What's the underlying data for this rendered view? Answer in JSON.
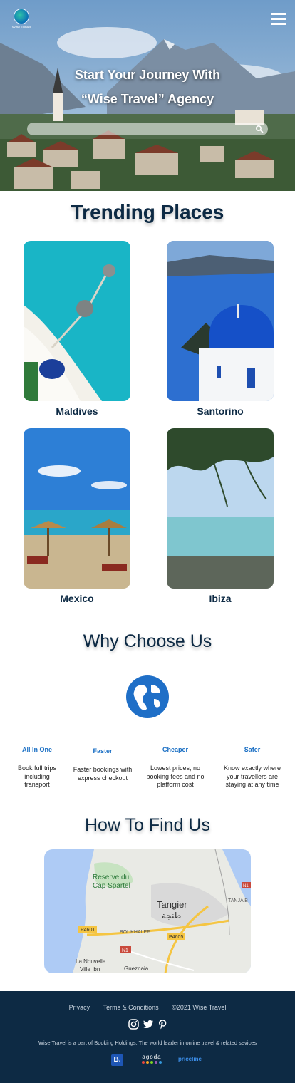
{
  "header": {
    "logo_text": "Wise Travel",
    "hero_title_line1": "Start Your Journey With",
    "hero_title_line2": "“Wise Travel” Agency",
    "search_placeholder": ""
  },
  "trending": {
    "title": "Trending Places",
    "places": [
      {
        "name": "Maldives"
      },
      {
        "name": "Santorino"
      },
      {
        "name": "Mexico"
      },
      {
        "name": "Ibiza"
      }
    ]
  },
  "why": {
    "title": "Why Choose Us",
    "features": [
      {
        "title": "All In One",
        "desc": "Book full trips including transport"
      },
      {
        "title": "Faster",
        "desc": "Faster bookings with express checkout"
      },
      {
        "title": "Cheaper",
        "desc": "Lowest prices, no booking fees and no platform cost"
      },
      {
        "title": "Safer",
        "desc": "Know exactly where your travellers are staying at any time"
      }
    ]
  },
  "find": {
    "title": "How To Find Us",
    "map_labels": {
      "reserve": "Reserve du",
      "cap": "Cap Spartel",
      "city": "Tangier",
      "city_ar": "طنجة",
      "boukhalef": "BOUKHALEF",
      "p4601": "P4601",
      "p4605": "P4605",
      "n1a": "N1",
      "n1b": "N1",
      "nouvelle1": "La Nouvelle",
      "nouvelle2": "Ville Ibn",
      "gueznaia": "Gueznaia",
      "tanja": "TANJA B"
    }
  },
  "footer": {
    "privacy": "Privacy",
    "terms": "Terms & Conditions",
    "copyright": "©2021 Wise Travel",
    "note": "Wise Travel is a part of Booking Holdings, The world leader in online travel & related sevices",
    "partners": {
      "booking": "B.",
      "agoda": "agoda",
      "priceline": "priceline"
    }
  }
}
